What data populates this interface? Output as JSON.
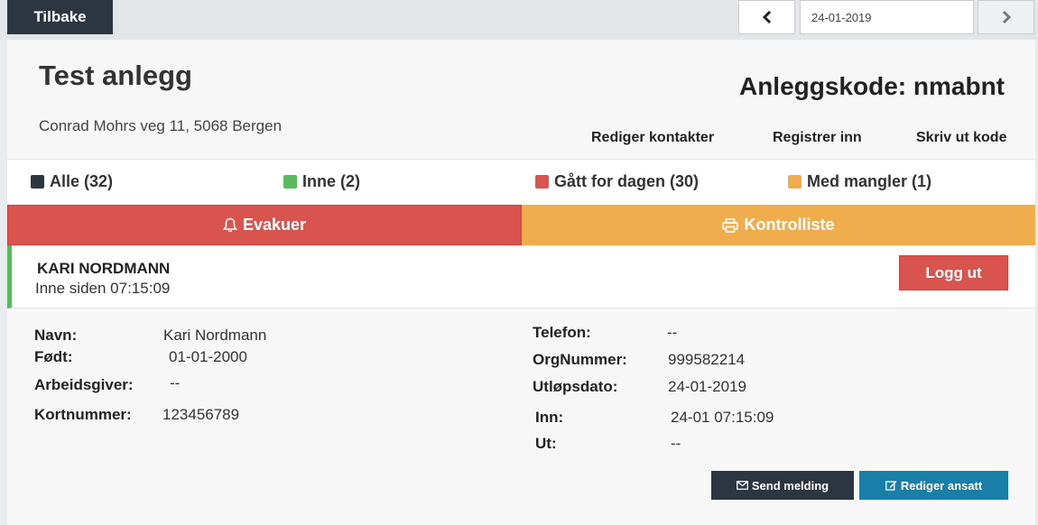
{
  "topbar": {
    "back_label": "Tilbake",
    "date_value": "24-01-2019"
  },
  "header": {
    "title": "Test anlegg",
    "address": "Conrad Mohrs veg 11, 5068 Bergen",
    "code_label": "Anleggskode:",
    "code_value": "nmabnt",
    "links": {
      "edit_contacts": "Rediger kontakter",
      "register_in": "Registrer inn",
      "print_code": "Skriv ut kode"
    }
  },
  "filters": {
    "all": "Alle (32)",
    "in": "Inne (2)",
    "gone": "Gått for dagen (30)",
    "deficient": "Med mangler (1)"
  },
  "colors": {
    "dark": "#2c3640",
    "green": "#5cb85c",
    "red": "#d9534f",
    "orange": "#f0ad4e",
    "blue": "#1a7fa8"
  },
  "actions": {
    "evacuate": "Evakuer",
    "checklist": "Kontrolliste"
  },
  "person": {
    "name_upper": "KARI NORDMANN",
    "status": "Inne siden 07:15:09",
    "logout": "Logg ut",
    "details_left": {
      "navn_label": "Navn:",
      "navn_value": "Kari Nordmann",
      "fodt_label": "Født:",
      "fodt_value": "01-01-2000",
      "arbeidsgiver_label": "Arbeidsgiver:",
      "arbeidsgiver_value": "--",
      "kortnummer_label": "Kortnummer:",
      "kortnummer_value": "123456789"
    },
    "details_right": {
      "telefon_label": "Telefon:",
      "telefon_value": "--",
      "orgnummer_label": "OrgNummer:",
      "orgnummer_value": "999582214",
      "utlopsdato_label": "Utløpsdato:",
      "utlopsdato_value": "24-01-2019",
      "inn_label": "Inn:",
      "inn_value": "24-01 07:15:09",
      "ut_label": "Ut:",
      "ut_value": "--"
    },
    "send_message": "Send melding",
    "edit_employee": "Rediger ansatt"
  }
}
